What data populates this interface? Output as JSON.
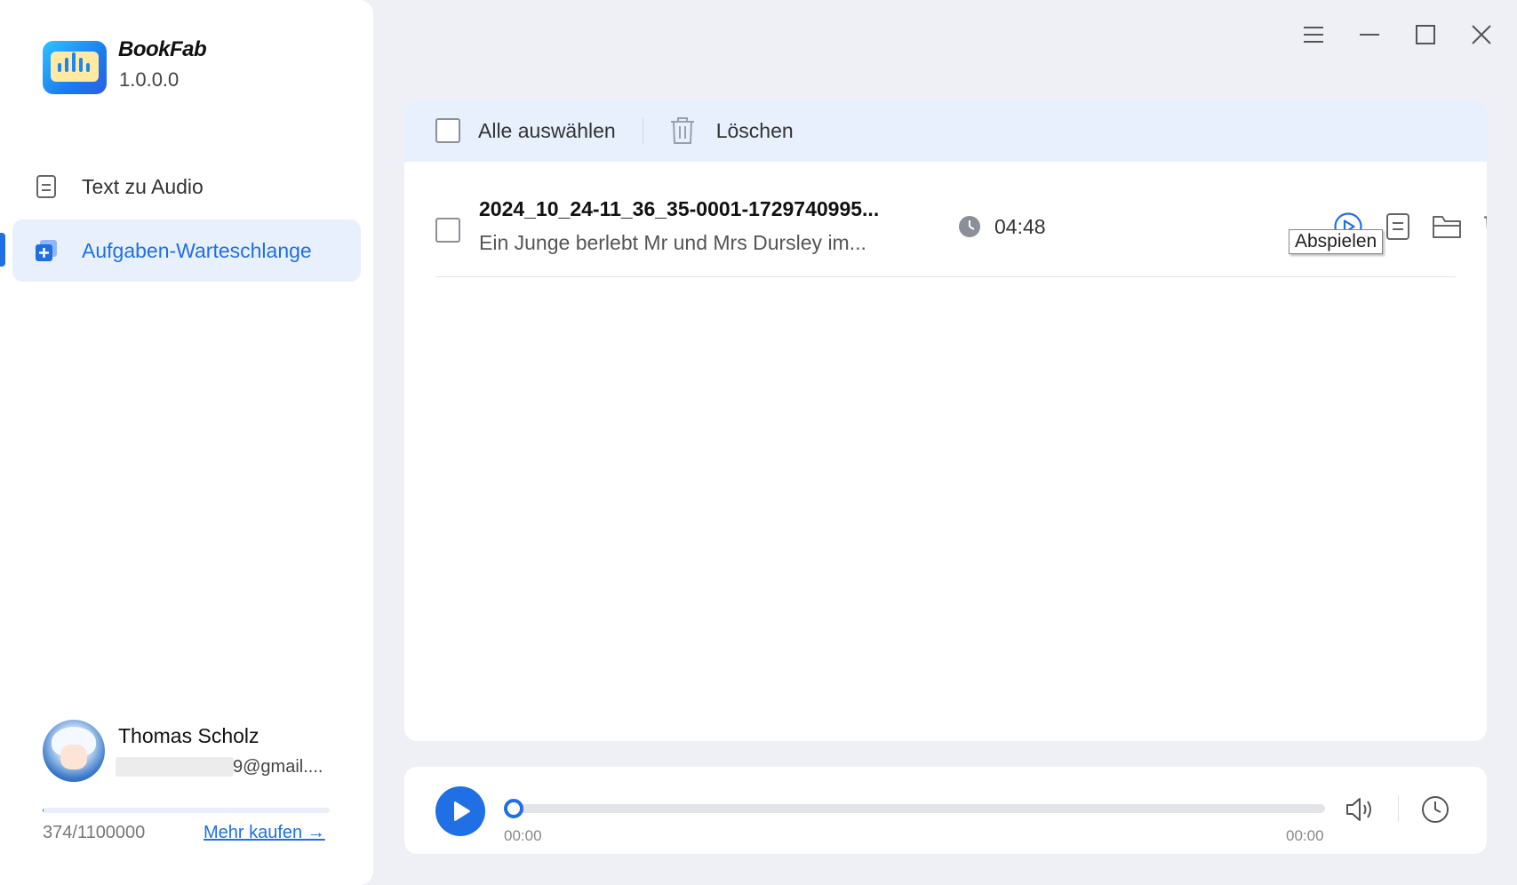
{
  "app": {
    "name": "BookFab",
    "version": "1.0.0.0"
  },
  "sidebar": {
    "items": [
      {
        "label": "Text zu Audio",
        "icon": "document-icon",
        "active": false
      },
      {
        "label": "Aufgaben-Warteschlange",
        "icon": "queue-icon",
        "active": true
      }
    ]
  },
  "user": {
    "name": "Thomas Scholz",
    "email": "9@gmail....",
    "quota": "374/1100000",
    "quota_fraction": 0.00034,
    "buy_label": "Mehr kaufen →"
  },
  "window": {
    "controls": [
      "menu-icon",
      "minimize-icon",
      "maximize-icon",
      "close-icon"
    ]
  },
  "toolbar": {
    "select_all_label": "Alle auswählen",
    "delete_label": "Löschen"
  },
  "tasks": [
    {
      "title": "2024_10_24-11_36_35-0001-1729740995...",
      "subtitle": "Ein Junge berlebt Mr und Mrs Dursley im...",
      "duration": "04:48"
    }
  ],
  "tooltip": "Abspielen",
  "player": {
    "current_time": "00:00",
    "total_time": "00:00",
    "progress": 0
  },
  "colors": {
    "accent": "#1f6fe5",
    "active_bg": "#e8f0fd",
    "background": "#eef0f5"
  }
}
